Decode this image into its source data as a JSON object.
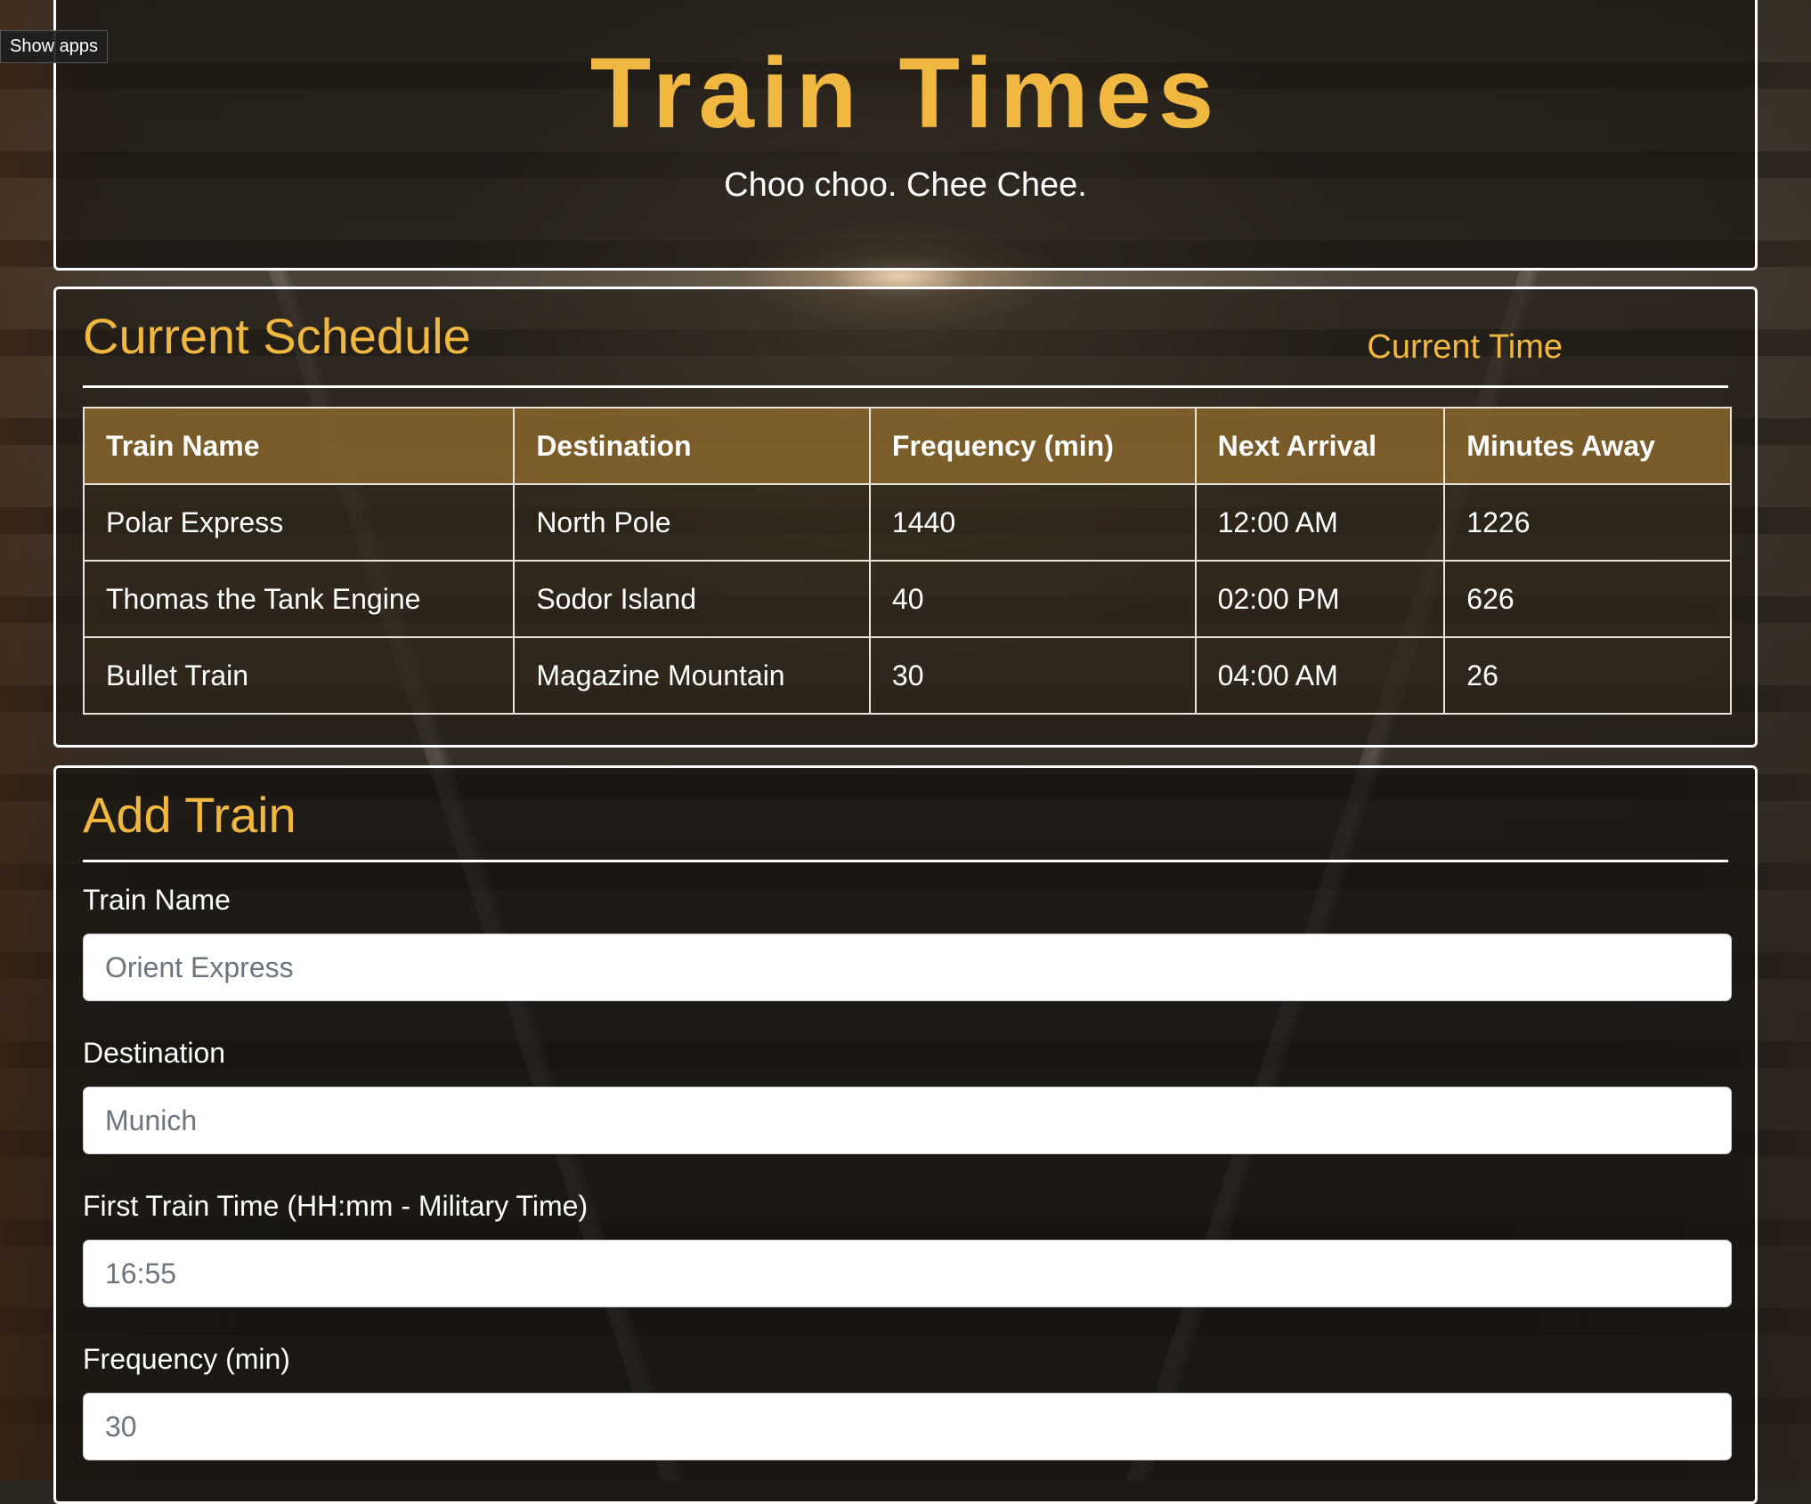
{
  "overlay": {
    "show_apps_label": "Show apps"
  },
  "header": {
    "title": "Train Times",
    "subtitle": "Choo choo. Chee Chee."
  },
  "schedule": {
    "title": "Current Schedule",
    "current_time_label": "Current Time",
    "columns": [
      "Train Name",
      "Destination",
      "Frequency (min)",
      "Next Arrival",
      "Minutes Away"
    ],
    "rows": [
      [
        "Polar Express",
        "North Pole",
        "1440",
        "12:00 AM",
        "1226"
      ],
      [
        "Thomas the Tank Engine",
        "Sodor Island",
        "40",
        "02:00 PM",
        "626"
      ],
      [
        "Bullet Train",
        "Magazine Mountain",
        "30",
        "04:00 AM",
        "26"
      ]
    ]
  },
  "add_train": {
    "title": "Add Train",
    "fields": [
      {
        "label": "Train Name",
        "placeholder": "Orient Express"
      },
      {
        "label": "Destination",
        "placeholder": "Munich"
      },
      {
        "label": "First Train Time (HH:mm - Military Time)",
        "placeholder": "16:55"
      },
      {
        "label": "Frequency (min)",
        "placeholder": "30"
      }
    ]
  },
  "colors": {
    "accent": "#f1b841",
    "table_header_bg": "#8c692d",
    "panel_border": "#ffffff"
  }
}
